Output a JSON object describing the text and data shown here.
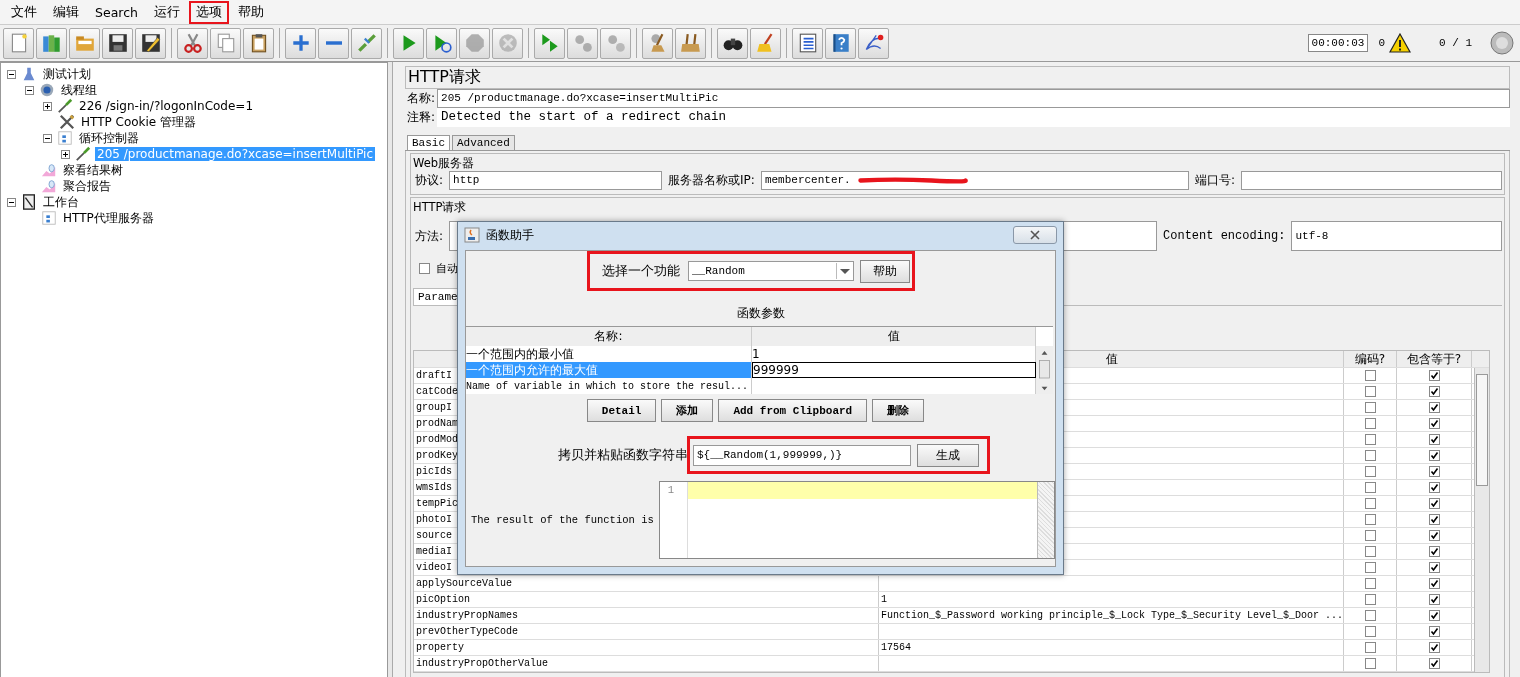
{
  "menu": [
    {
      "label": "文件",
      "highlighted": false
    },
    {
      "label": "编辑",
      "highlighted": false
    },
    {
      "label": "Search",
      "highlighted": false
    },
    {
      "label": "运行",
      "highlighted": false
    },
    {
      "label": "选项",
      "highlighted": true
    },
    {
      "label": "帮助",
      "highlighted": false
    }
  ],
  "toolbar": [
    [
      {
        "kind": "new",
        "disabled": false
      },
      {
        "kind": "templates",
        "disabled": false
      },
      {
        "kind": "open",
        "disabled": false
      },
      {
        "kind": "save",
        "disabled": false
      },
      {
        "kind": "save_as",
        "disabled": false
      }
    ],
    [
      {
        "kind": "cut",
        "disabled": false
      },
      {
        "kind": "copy",
        "disabled": false
      },
      {
        "kind": "paste",
        "disabled": false
      }
    ],
    [
      {
        "kind": "expand",
        "disabled": false
      },
      {
        "kind": "collapse",
        "disabled": false
      },
      {
        "kind": "toggle",
        "disabled": false
      }
    ],
    [
      {
        "kind": "start",
        "disabled": false
      },
      {
        "kind": "start_no_pause",
        "disabled": false
      },
      {
        "kind": "stop",
        "disabled": true
      },
      {
        "kind": "shutdown",
        "disabled": true
      }
    ],
    [
      {
        "kind": "remote_start",
        "disabled": false
      },
      {
        "kind": "remote_stop",
        "disabled": true
      },
      {
        "kind": "remote_shutdown",
        "disabled": true
      }
    ],
    [
      {
        "kind": "clear",
        "disabled": false
      },
      {
        "kind": "clear_all",
        "disabled": false
      }
    ],
    [
      {
        "kind": "search",
        "disabled": false
      },
      {
        "kind": "reset_search",
        "disabled": false
      }
    ],
    [
      {
        "kind": "function_helper",
        "disabled": false
      },
      {
        "kind": "help",
        "disabled": false
      },
      {
        "kind": "plugins",
        "disabled": false
      }
    ]
  ],
  "status": {
    "timer": "00:00:03",
    "warnings": "0",
    "threads": "0 / 1"
  },
  "tree": [
    {
      "label": "测试计划",
      "kind": "test_plan",
      "expanded": true,
      "selected": false,
      "children": [
        {
          "label": "线程组",
          "kind": "thread_group",
          "expanded": true,
          "selected": false,
          "children": [
            {
              "label": "226 /sign-in/?logonInCode=1",
              "kind": "sampler",
              "expanded": false,
              "selected": false
            },
            {
              "label": "HTTP Cookie 管理器",
              "kind": "config",
              "selected": false
            },
            {
              "label": "循环控制器",
              "kind": "controller",
              "expanded": true,
              "selected": false,
              "children": [
                {
                  "label": "205 /productmanage.do?xcase=insertMultiPic",
                  "kind": "sampler",
                  "expanded": false,
                  "selected": true
                }
              ]
            }
          ]
        },
        {
          "label": "察看结果树",
          "kind": "listener",
          "selected": false
        },
        {
          "label": "聚合报告",
          "kind": "listener",
          "selected": false
        }
      ]
    },
    {
      "label": "工作台",
      "kind": "workbench",
      "expanded": true,
      "selected": false,
      "children": [
        {
          "label": "HTTP代理服务器",
          "kind": "proxy",
          "selected": false
        }
      ]
    }
  ],
  "sampler": {
    "title": "HTTP请求",
    "name_label": "名称:",
    "name": "205 /productmanage.do?xcase=insertMultiPic",
    "comment_label": "注释:",
    "comment": "Detected the start of a redirect chain",
    "tabs": [
      {
        "label": "Basic",
        "selected": true
      },
      {
        "label": "Advanced",
        "selected": false
      }
    ],
    "web_server": {
      "title": "Web服务器",
      "protocol_label": "协议:",
      "protocol": "http",
      "server_label": "服务器名称或IP:",
      "server": "membercenter.",
      "redacted": true,
      "port_label": "端口号:"
    },
    "http_request": {
      "title": "HTTP请求",
      "method_label": "方法:",
      "encoding_label": "Content encoding:",
      "encoding": "utf-8",
      "auto_label": "自动",
      "auto_checked": false,
      "params_tab": "Parame"
    },
    "params": {
      "columns": [
        "值",
        "编码?",
        "包含等于?"
      ],
      "rows": [
        {
          "name": "draftI",
          "value": "",
          "encode": false,
          "include_equals": true
        },
        {
          "name": "catCode",
          "value": "",
          "encode": false,
          "include_equals": true
        },
        {
          "name": "groupI",
          "value": "",
          "encode": false,
          "include_equals": true
        },
        {
          "name": "prodNam",
          "value": "",
          "encode": false,
          "include_equals": true
        },
        {
          "name": "prodMod",
          "value": "",
          "encode": false,
          "include_equals": true
        },
        {
          "name": "prodKey",
          "value": "",
          "encode": false,
          "include_equals": true
        },
        {
          "name": "picIds",
          "value": "",
          "encode": false,
          "include_equals": true
        },
        {
          "name": "wmsIds",
          "value": "",
          "encode": false,
          "include_equals": true
        },
        {
          "name": "tempPic",
          "value": "",
          "encode": false,
          "include_equals": true
        },
        {
          "name": "photoI",
          "value": "",
          "encode": false,
          "include_equals": true
        },
        {
          "name": "source",
          "value": "",
          "encode": false,
          "include_equals": true
        },
        {
          "name": "mediaI",
          "value": "",
          "encode": false,
          "include_equals": true
        },
        {
          "name": "videoI",
          "value": "",
          "encode": false,
          "include_equals": true
        },
        {
          "name": "applySourceValue",
          "value": "",
          "encode": false,
          "include_equals": true
        },
        {
          "name": "picOption",
          "value": "1",
          "encode": false,
          "include_equals": true
        },
        {
          "name": "industryPropNames",
          "value": "Function_$_Password working principle_$_Lock Type_$_Security Level_$_Door ...",
          "encode": false,
          "include_equals": true
        },
        {
          "name": "prevOtherTypeCode",
          "value": "",
          "encode": false,
          "include_equals": true
        },
        {
          "name": "property",
          "value": "17564",
          "encode": false,
          "include_equals": true
        },
        {
          "name": "industryPropOtherValue",
          "value": "",
          "encode": false,
          "include_equals": true
        }
      ]
    }
  },
  "dialog": {
    "title": "函数助手",
    "function_label": "选择一个功能",
    "function": "__Random",
    "help_button": "帮助",
    "function_row_highlighted": true,
    "params_title": "函数参数",
    "columns": [
      "名称:",
      "值"
    ],
    "rows": [
      {
        "name": "一个范围内的最小值",
        "value": "1",
        "selected": false
      },
      {
        "name": "一个范围内允许的最大值",
        "value": "999999",
        "selected": true
      },
      {
        "name": "Name of variable in which to store the resul...",
        "value": "",
        "selected": false
      }
    ],
    "buttons": [
      "Detail",
      "添加",
      "Add from Clipboard",
      "删除"
    ],
    "string_label": "拷贝并粘贴函数字符串",
    "string": "${__Random(1,999999,)}",
    "generate_button": "生成",
    "generate_row_highlighted": true,
    "result_label": "The result of the function is",
    "line_number": "1"
  }
}
